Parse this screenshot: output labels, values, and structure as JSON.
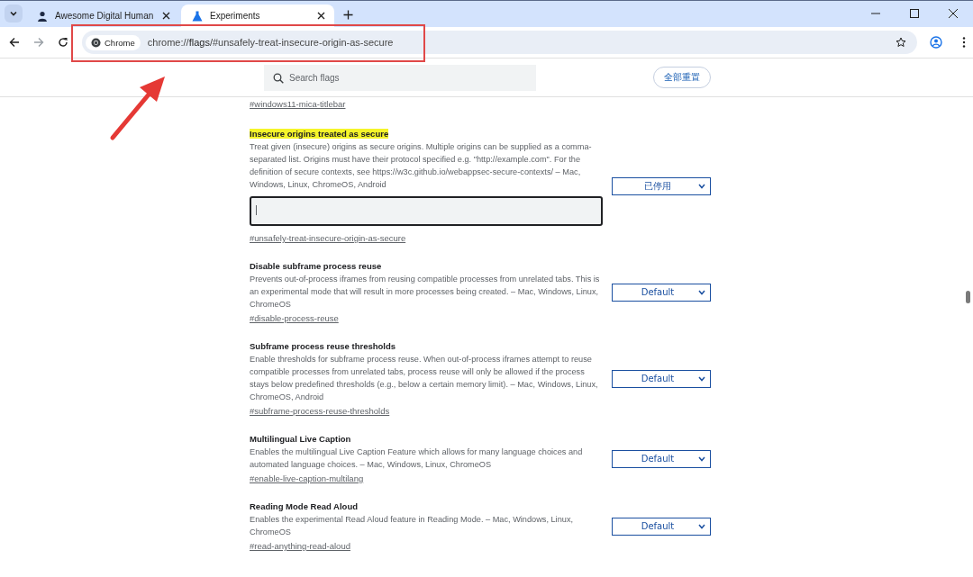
{
  "tabs": [
    {
      "title": "Awesome Digital Human",
      "kind": "person",
      "selected": false
    },
    {
      "title": "Experiments",
      "kind": "flask",
      "selected": true
    }
  ],
  "address_bar": {
    "chip": "Chrome",
    "url_prefix": "chrome://",
    "url_host": "flags",
    "url_rest": "/#unsafely-treat-insecure-origin-as-secure"
  },
  "search": {
    "placeholder": "Search flags"
  },
  "reset_button": "全部重置",
  "previous_link": "#windows11-mica-titlebar",
  "flags": [
    {
      "title": "Insecure origins treated as secure",
      "highlighted": true,
      "kind": "text-input",
      "description": "Treat given (insecure) origins as secure origins. Multiple origins can be supplied as a comma-separated list. Origins must have their protocol specified e.g. \"http://example.com\". For the definition of secure contexts, see https://w3c.github.io/webappsec-secure-contexts/ – Mac, Windows, Linux, ChromeOS, Android",
      "link": "#unsafely-treat-insecure-origin-as-secure",
      "value": "已停用"
    },
    {
      "title": "Disable subframe process reuse",
      "highlighted": false,
      "kind": "plain",
      "description": "Prevents out-of-process iframes from reusing compatible processes from unrelated tabs. This is an experimental mode that will result in more processes being created. – Mac, Windows, Linux, ChromeOS",
      "link": "#disable-process-reuse",
      "value": "Default"
    },
    {
      "title": "Subframe process reuse thresholds",
      "highlighted": false,
      "kind": "plain",
      "description": "Enable thresholds for subframe process reuse. When out-of-process iframes attempt to reuse compatible processes from unrelated tabs, process reuse will only be allowed if the process stays below predefined thresholds (e.g., below a certain memory limit). – Mac, Windows, Linux, ChromeOS, Android",
      "link": "#subframe-process-reuse-thresholds",
      "value": "Default"
    },
    {
      "title": "Multilingual Live Caption",
      "highlighted": false,
      "kind": "plain",
      "description": "Enables the multilingual Live Caption Feature which allows for many language choices and automated language choices. – Mac, Windows, Linux, ChromeOS",
      "link": "#enable-live-caption-multilang",
      "value": "Default"
    },
    {
      "title": "Reading Mode Read Aloud",
      "highlighted": false,
      "kind": "plain",
      "description": "Enables the experimental Read Aloud feature in Reading Mode. – Mac, Windows, Linux, ChromeOS",
      "link": "#read-anything-read-aloud",
      "value": "Default"
    }
  ]
}
